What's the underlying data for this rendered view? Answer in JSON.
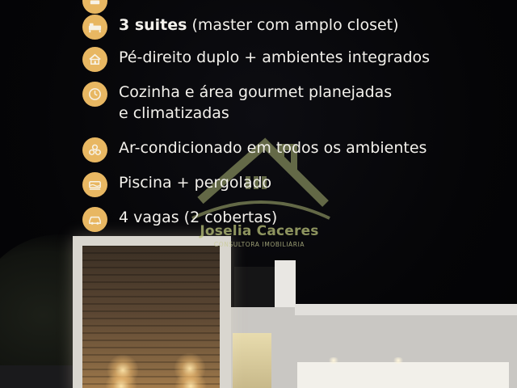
{
  "features": [
    {
      "icon": "partial-icon",
      "label": "",
      "detail": ""
    },
    {
      "icon": "bed-icon",
      "label": "3 suites",
      "detail": " (master com amplo closet)"
    },
    {
      "icon": "ceiling-icon",
      "label": "Pé-direito duplo + ambientes integrados",
      "detail": ""
    },
    {
      "icon": "kitchen-icon",
      "label": "Cozinha e área gourmet planejadas",
      "label_line2": "e climatizadas"
    },
    {
      "icon": "air-conditioner-icon",
      "label": "Ar-condicionado em todos os ambientes"
    },
    {
      "icon": "pool-icon",
      "label": "Piscina + pergolado"
    },
    {
      "icon": "car-icon",
      "label": "4 vagas (2 cobertas)"
    }
  ],
  "watermark": {
    "brand": "Joselia Caceres",
    "subtitle": "CONSULTORA IMOBILIÁRIA"
  },
  "colors": {
    "icon_background": "#e8b762",
    "text": "#f3f1ec",
    "background": "#050507"
  }
}
